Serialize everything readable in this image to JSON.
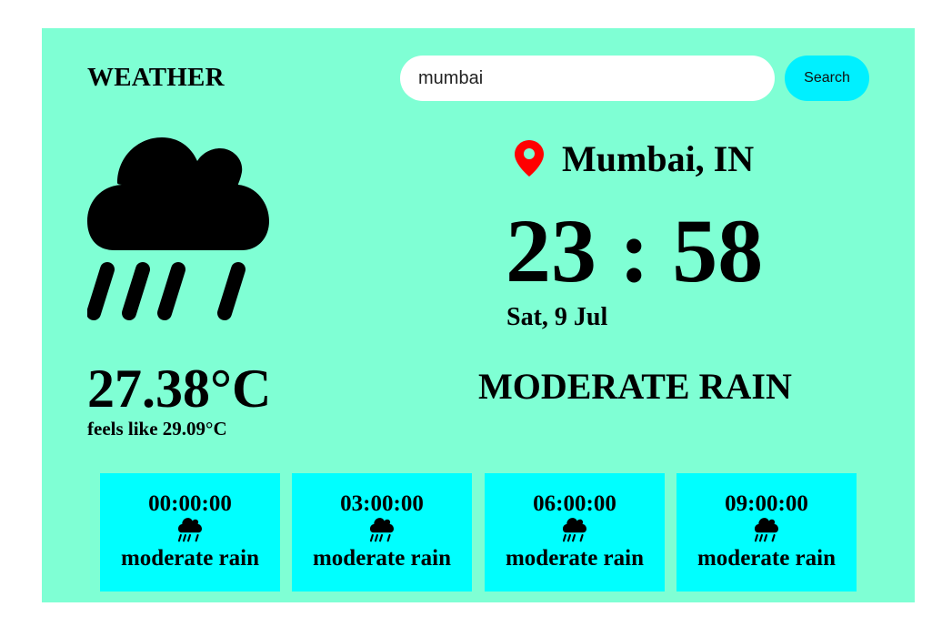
{
  "header": {
    "brand": "WEATHER",
    "search": {
      "value": "mumbai",
      "button_label": "Search"
    }
  },
  "current": {
    "icon": "rain-cloud-icon",
    "location": "Mumbai, IN",
    "location_icon": "location-pin-icon",
    "time": "23 : 58",
    "date": "Sat, 9 Jul",
    "temperature": "27.38°C",
    "feels_like": "feels like 29.09°C",
    "condition": "MODERATE RAIN"
  },
  "forecast": [
    {
      "time": "00:00:00",
      "icon": "rain-cloud-icon",
      "description": "moderate rain"
    },
    {
      "time": "03:00:00",
      "icon": "rain-cloud-icon",
      "description": "moderate rain"
    },
    {
      "time": "06:00:00",
      "icon": "rain-cloud-icon",
      "description": "moderate rain"
    },
    {
      "time": "09:00:00",
      "icon": "rain-cloud-icon",
      "description": "moderate rain"
    }
  ],
  "colors": {
    "page_background": "#ffffff",
    "card_background": "#7fffd4",
    "button_background": "#00f0ff",
    "forecast_background": "#00ffff",
    "pin": "#ff0000",
    "text": "#000000"
  }
}
